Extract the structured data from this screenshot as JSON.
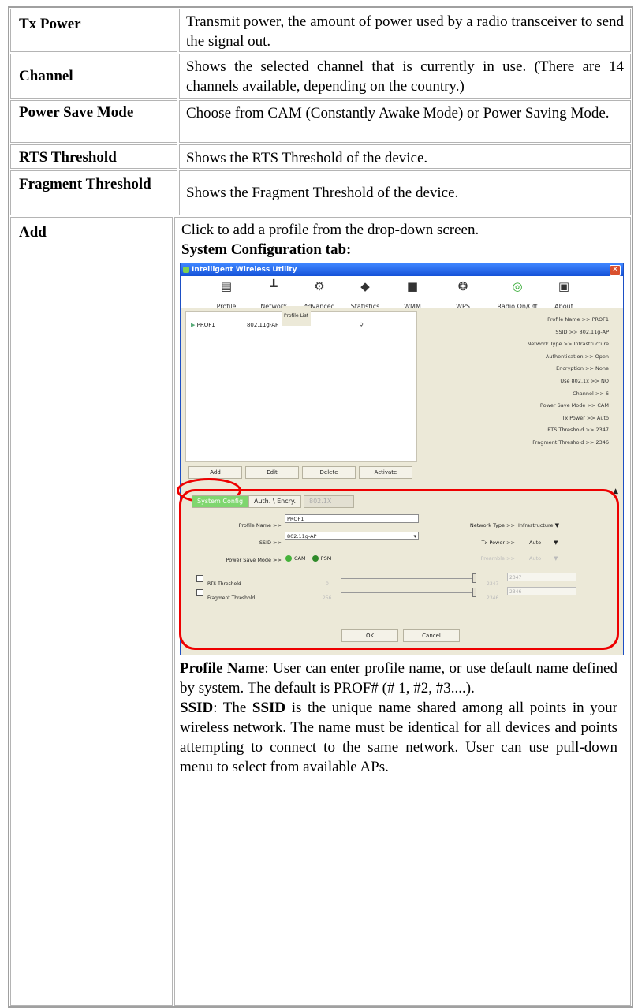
{
  "rows": [
    {
      "label": "Tx Power",
      "desc": "Transmit power, the amount of power used by a radio transceiver to send the signal out."
    },
    {
      "label": "Channel",
      "desc": "Shows the selected channel that is currently in use. (There are 14 channels available, depending on the country.)"
    },
    {
      "label": "Power Save Mode",
      "desc": "Choose from CAM (Constantly Awake Mode) or Power Saving Mode."
    },
    {
      "label": "RTS Threshold",
      "desc": "Shows the RTS Threshold of the device."
    },
    {
      "label": "Fragment Threshold",
      "desc": "Shows the Fragment Threshold of the device."
    },
    {
      "label": "Add",
      "desc": "Click to add a profile from the drop-down screen."
    }
  ],
  "sys_config_heading": "System Configuration tab:",
  "window": {
    "title": "Intelligent Wireless Utility",
    "toolbar": [
      "Profile",
      "Network",
      "Advanced",
      "Statistics",
      "WMM",
      "WPS",
      "Radio On/Off",
      "About"
    ],
    "profile_list_legend": "Profile List",
    "profile_name": "PROF1",
    "profile_ssid": "802.11g-AP",
    "buttons": [
      "Add",
      "Edit",
      "Delete",
      "Activate"
    ],
    "info": [
      "Profile Name >> PROF1",
      "SSID >> 802.11g-AP",
      "Network Type >> Infrastructure",
      "Authentication >> Open",
      "Encryption >> None",
      "Use 802.1x >> NO",
      "Channel >> 6",
      "Power Save Mode >> CAM",
      "Tx Power >> Auto",
      "RTS Threshold >> 2347",
      "Fragment Threshold >> 2346"
    ],
    "tabs": [
      "System Config",
      "Auth. \\ Encry.",
      "802.1X"
    ],
    "profile_name_label": "Profile Name >>",
    "profile_name_value": "PROF1",
    "ssid_label": "SSID >>",
    "ssid_value": "802.11g-AP",
    "power_save_label": "Power Save Mode >>",
    "cam_label": "CAM",
    "psm_label": "PSM",
    "network_type_label": "Network Type >>",
    "network_type_value": "Infrastructure",
    "tx_power_label": "Tx Power >>",
    "tx_power_value": "Auto",
    "preamble_label": "Preamble >>",
    "preamble_value": "Auto",
    "rts_label": "RTS Threshold",
    "rts_min": "0",
    "rts_max": "2347",
    "rts_value": "2347",
    "frag_label": "Fragment Threshold",
    "frag_min": "256",
    "frag_max": "2346",
    "frag_value": "2346",
    "ok": "OK",
    "cancel": "Cancel"
  },
  "profile_name_text": {
    "term": "Profile Name",
    "body": ": User can enter profile name, or use default name defined by system. The default is PROF# (# 1, #2, #3....)."
  },
  "ssid_text": {
    "term1": "SSID",
    "mid": ": The ",
    "term2": "SSID",
    "body": " is the unique name shared among all points in your wireless network. The name must be identical for all devices and points attempting to connect to the same network. User can use pull-down menu to select from available APs."
  }
}
